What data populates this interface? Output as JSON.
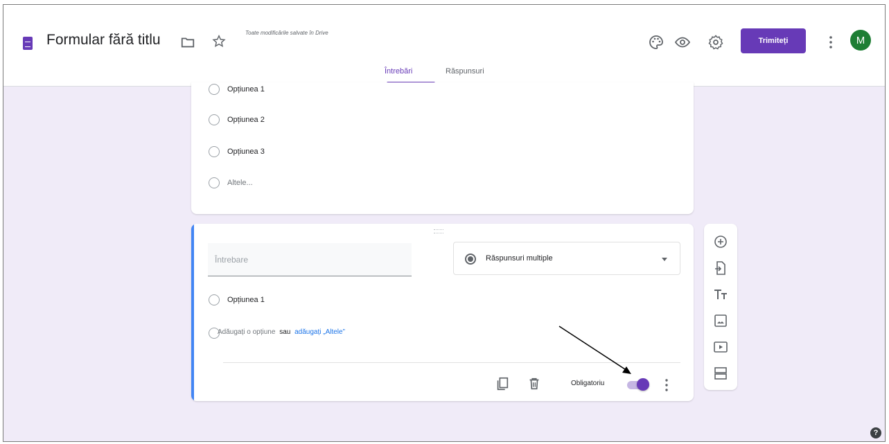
{
  "header": {
    "form_title": "Formular fără titlu",
    "save_status": "Toate modificările salvate în Drive",
    "send_label": "Trimiteți",
    "avatar_letter": "M",
    "tabs": [
      {
        "label": "Întrebări",
        "active": true
      },
      {
        "label": "Răspunsuri",
        "active": false
      }
    ]
  },
  "previous_question": {
    "options": [
      "Opțiunea 1",
      "Opțiunea 2",
      "Opțiunea 3"
    ],
    "other_label": "Altele..."
  },
  "active_question": {
    "placeholder": "Întrebare",
    "type_label": "Răspunsuri multiple",
    "options": [
      "Opțiunea 1"
    ],
    "add_option_label": "Adăugați o opțiune",
    "or_label": "sau",
    "add_other_label": "adăugați „Altele”",
    "required_label": "Obligatoriu",
    "required": true
  },
  "side_toolbar": {
    "icons": [
      "add-question-icon",
      "import-questions-icon",
      "add-title-icon",
      "add-image-icon",
      "add-video-icon",
      "add-section-icon"
    ]
  },
  "colors": {
    "accent": "#673ab7",
    "background": "#f0ebf8",
    "active_bar": "#4285f4",
    "link": "#1a73e8"
  }
}
